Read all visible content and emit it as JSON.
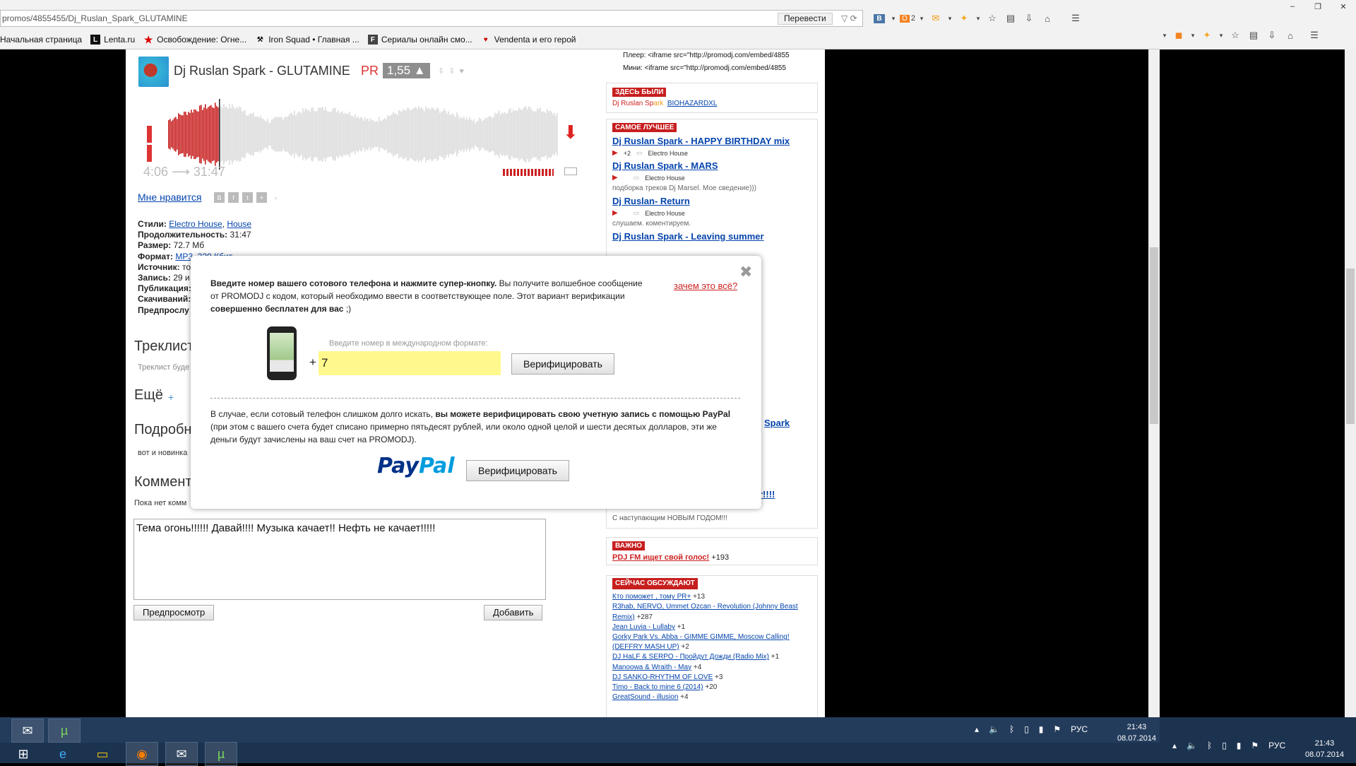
{
  "browser": {
    "url": "promos/4855455/Dj_Ruslan_Spark_GLUTAMINE",
    "translate_label": "Перевести",
    "toolbar_counts": {
      "ok": "2"
    },
    "bookmarks": [
      {
        "label": "Начальная страница",
        "icon": "L",
        "icon_name": "lenta-icon-start"
      },
      {
        "label": "Lenta.ru",
        "icon": "L",
        "icon_name": "lenta-icon"
      },
      {
        "label": "Освобождение: Огне...",
        "icon": "★",
        "icon_name": "star-icon"
      },
      {
        "label": "Iron Squad • Главная ...",
        "icon": "⚒",
        "icon_name": "iron-squad-icon"
      },
      {
        "label": "Сериалы онлайн смо...",
        "icon": "F",
        "icon_name": "serials-icon"
      },
      {
        "label": "Vendenta и его герой",
        "icon": "♥",
        "icon_name": "vendenta-icon"
      }
    ]
  },
  "track": {
    "title": "Dj Ruslan Spark - GLUTAMINE",
    "pr": "PR",
    "rating": "1,55 ▲",
    "time": "4:06 ⟶ 31:47",
    "like": "Мне нравится",
    "meta": [
      {
        "k": "Стили:",
        "v": "",
        "links": [
          "Electro House",
          "House"
        ]
      },
      {
        "k": "Продолжительность:",
        "v": " 31:47"
      },
      {
        "k": "Размер:",
        "v": " 72.7 Мб"
      },
      {
        "k": "Формат:",
        "v": "",
        "links": [
          "MP3, 320 Кбит"
        ]
      },
      {
        "k": "Источник:",
        "v": " то"
      },
      {
        "k": "Запись:",
        "v": " 29 и"
      },
      {
        "k": "Публикация:",
        "v": ""
      },
      {
        "k": "Скачиваний:",
        "v": ""
      },
      {
        "k": "Предпрослу",
        "v": ""
      }
    ],
    "playback_fraction": 0.13
  },
  "sections": {
    "tracklist_h": "Треклист",
    "tracklist_sub": "Треклист буде",
    "more_h": "Ещё",
    "more_plus": "+",
    "details_h": "Подробн",
    "details_sub": "вот и новинка",
    "comments_h": "Коммент",
    "comments_sub": "Пока нет комм",
    "comment_text": "Тема огонь!!!!!! Давай!!!! Музыка качает!! Нефть не качает!!!!!",
    "preview_btn": "Предпросмотр",
    "add_btn": "Добавить"
  },
  "sidebar": {
    "embed_player": "Плеер: <iframe src=\"http://promodj.com/embed/4855",
    "embed_mini": "Мини: <iframe src=\"http://promodj.com/embed/4855",
    "been_badge": "ЗДЕСЬ БЫЛИ",
    "been_user1_a": "Dj Ruslan Sp",
    "been_user1_b": "ark",
    "been_user2": "BIOHAZARDXL",
    "best_badge": "САМОЕ ЛУЧШЕЕ",
    "best": [
      {
        "title": "Dj Ruslan Spark - HAPPY BIRTHDAY mix",
        "count": "+2",
        "genre": "Electro House",
        "note": ""
      },
      {
        "title": "Dj Ruslan Spark - MARS",
        "count": "",
        "genre": "Electro House",
        "note": "подборка треков Dj Marsel. Мое сведение)))"
      },
      {
        "title": "Dj Ruslan- Return",
        "count": "",
        "genre": "Electro House",
        "note": "слушаем. коментируем."
      },
      {
        "title": "Dj Ruslan Spark - Leaving summer",
        "count": "",
        "genre": "",
        "note": ""
      }
    ],
    "spark_frag": "Spark",
    "ir_frag": "r!!!!",
    "newyear": "С наступающим НОВЫМ ГОДОМ!!!",
    "important_badge": "ВАЖНО",
    "important_link": "PDJ FM ищет свой голос!",
    "important_count": "+193",
    "discuss_badge": "СЕЙЧАС ОБСУЖДАЮТ",
    "discuss": [
      {
        "t": "Кто поможет , тому PR+",
        "c": "+13"
      },
      {
        "t": "R3hab, NERVO, Ummet Ozcan - Revolution (Johnny Beast Remix)",
        "c": "+287"
      },
      {
        "t": "Jean Luvia - Lullaby",
        "c": "+1"
      },
      {
        "t": "Gorky Park Vs. Abba - GIMME GIMME, Moscow Calling! (DEFFRY MASH UP)",
        "c": "+2"
      },
      {
        "t": "DJ HaLF & SERPO - Пройдут Дожди (Radio Mix)",
        "c": "+1"
      },
      {
        "t": "Manoowa & Wraith - May",
        "c": "+4"
      },
      {
        "t": "DJ SANKO-RHYTHM OF LOVE",
        "c": "+3"
      },
      {
        "t": "Timo - Back to mine 6 (2014)",
        "c": "+20"
      },
      {
        "t": "GreatSound - illusion",
        "c": "+4"
      }
    ]
  },
  "modal": {
    "intro_bold": "Введите номер вашего сотового телефона и нажмите супер-кнопку.",
    "intro_rest": " Вы получите волшебное сообщение от PROMODJ с кодом, который необходимо ввести в соответствующее поле. Этот вариант верификации ",
    "intro_bold2": "совершенно бесплатен для вас",
    "intro_end": " ;)",
    "why_link": "зачем это всё?",
    "phone_hint": "Введите номер в международном формате:",
    "plus": "+",
    "phone_value": "7",
    "verify_btn": "Верифицировать",
    "paypal_p1": "В случае, если сотовый телефон слишком долго искать, ",
    "paypal_bold": "вы можете верифицировать свою учетную запись с помощью PayPal",
    "paypal_p2": " (при этом с вашего счета будет списано примерно пятьдесят рублей, или около одной целой и шести десятых долларов, эти же деньги будут зачислены на ваш счет на PROMODJ).",
    "paypal_logo_a": "Pay",
    "paypal_logo_b": "Pal",
    "verify_btn2": "Верифицировать"
  },
  "taskbar": {
    "lang": "РУС",
    "time": "21:43",
    "date": "08.07.2014"
  },
  "colors": {
    "accent_red": "#c71e1e",
    "link_blue": "#0645ad",
    "input_yellow": "#fff88c"
  }
}
